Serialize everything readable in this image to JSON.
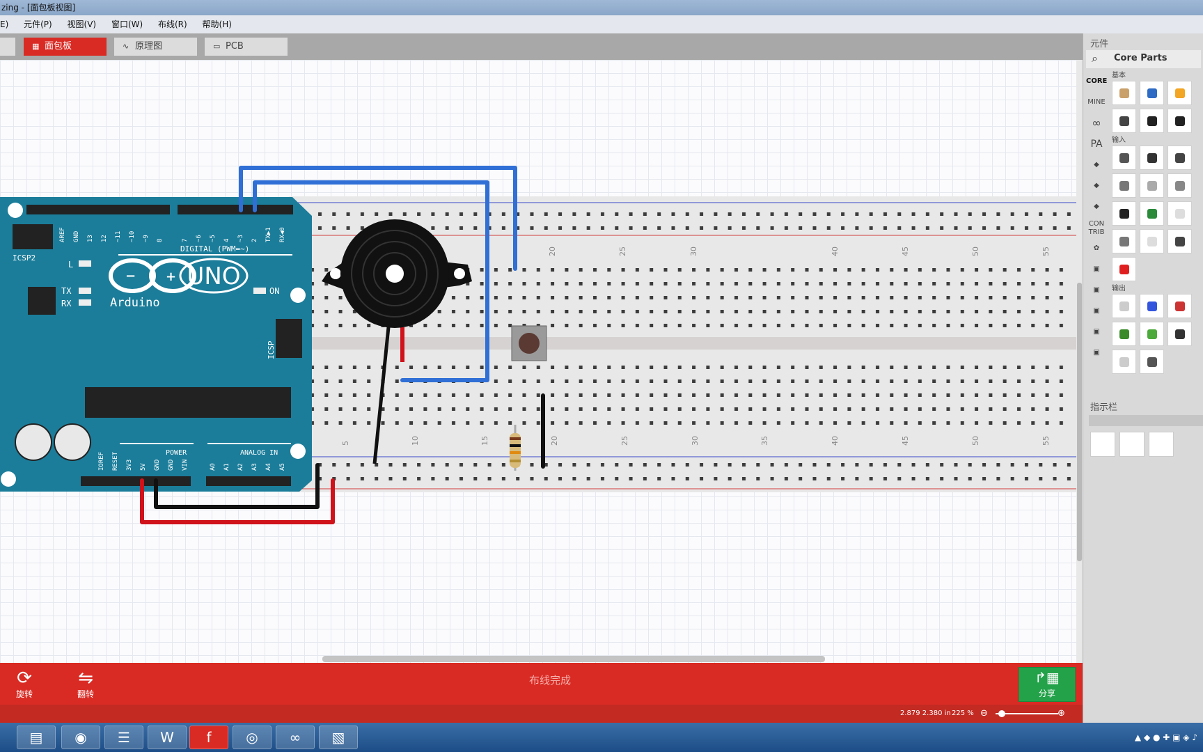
{
  "window": {
    "title": "zing - [面包板视图]"
  },
  "menu": {
    "items": [
      "E)",
      "元件(P)",
      "视图(V)",
      "窗口(W)",
      "布线(R)",
      "帮助(H)"
    ]
  },
  "tabs": [
    {
      "label": "面包板",
      "icon": "breadboard-icon",
      "active": true
    },
    {
      "label": "原理图",
      "icon": "schematic-icon",
      "active": false
    },
    {
      "label": "PCB",
      "icon": "pcb-icon",
      "active": false
    }
  ],
  "canvas": {
    "watermark": "zing",
    "breadboard_top_numbers": [
      "20",
      "25",
      "30",
      "40",
      "45",
      "50",
      "55"
    ],
    "breadboard_bottom_numbers": [
      "5",
      "10",
      "15",
      "20",
      "25",
      "30",
      "35",
      "40",
      "45",
      "50",
      "55"
    ],
    "arduino": {
      "brand": "Arduino",
      "model": "UNO",
      "digital_label": "DIGITAL (PWM=~)",
      "power_label": "POWER",
      "analog_label": "ANALOG IN",
      "icsp2_label": "ICSP2",
      "icsp_label": "ICSP",
      "on_label": "ON",
      "l_label": "L",
      "tx_label": "TX",
      "rx_label": "RX",
      "digital_pins": [
        "AREF",
        "GND",
        "13",
        "12",
        "~11",
        "~10",
        "~9",
        "8",
        "7",
        "~6",
        "~5",
        "4",
        "~3",
        "2",
        "TX▶1",
        "RX◀0"
      ],
      "power_pins": [
        "IOREF",
        "RESET",
        "3V3",
        "5V",
        "GND",
        "GND",
        "VIN"
      ],
      "analog_pins": [
        "A0",
        "A1",
        "A2",
        "A3",
        "A4",
        "A5"
      ]
    }
  },
  "parts_bin": {
    "title": "元件",
    "search_label": "Core Parts",
    "bins": [
      "CORE",
      "MINE",
      "∞",
      "PA",
      "CON TRIB"
    ],
    "categories": [
      {
        "label": "基本",
        "count": 6
      },
      {
        "label": "输入",
        "count": 13
      },
      {
        "label": "输出",
        "count": 8
      }
    ]
  },
  "inspector": {
    "title": "指示栏"
  },
  "toolbar": {
    "rotate_label": "旋转",
    "flip_label": "翻转",
    "status_message": "布线完成",
    "share_label": "分享"
  },
  "statusbar": {
    "coords": "2.879 2.380 in",
    "zoom": "225 %"
  },
  "colors": {
    "accent": "#d92b24",
    "share": "#23a24a",
    "arduino": "#1b7d9a",
    "wire_blue": "#2f6fd6",
    "wire_red": "#d0121b",
    "wire_black": "#111111"
  }
}
